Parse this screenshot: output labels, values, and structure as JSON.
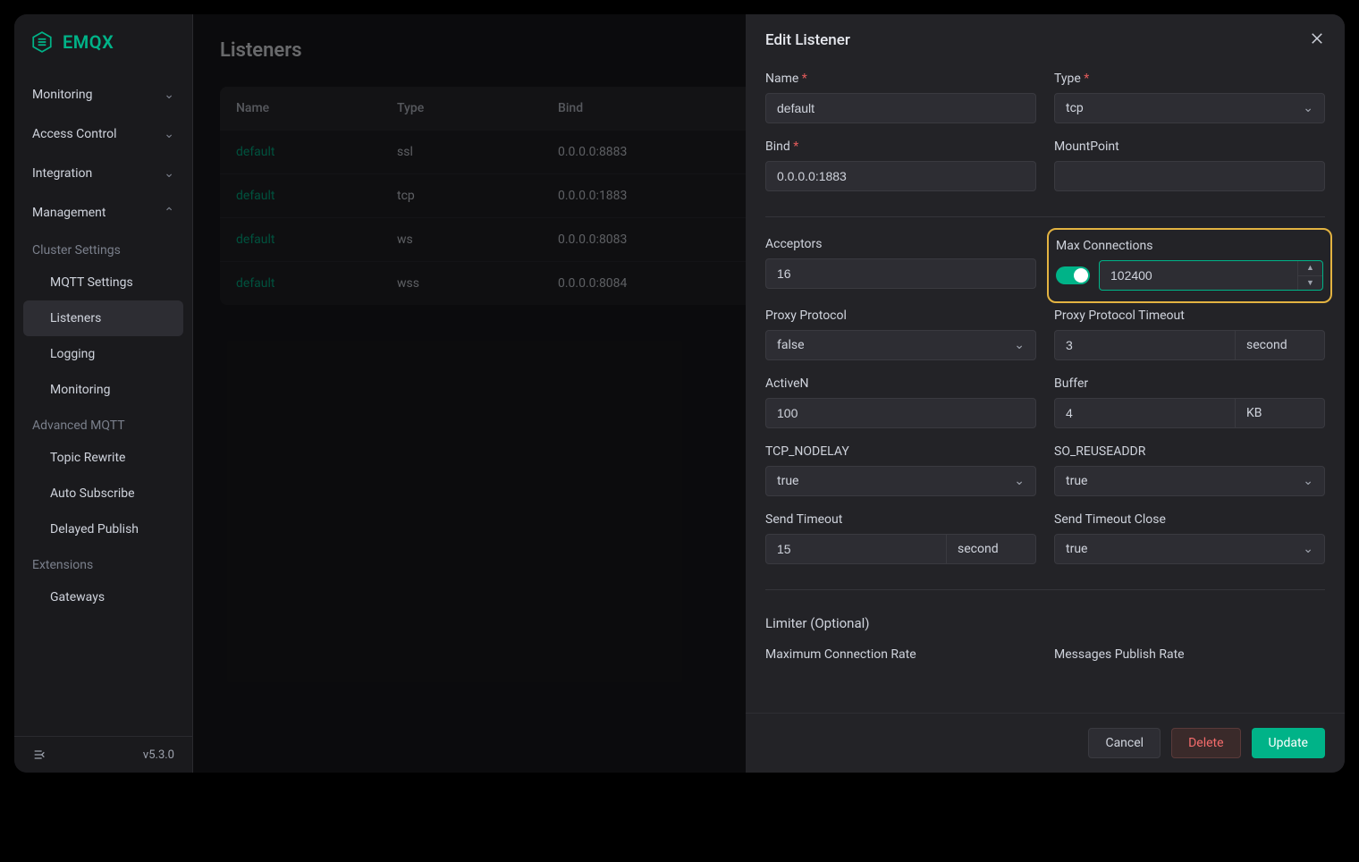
{
  "brand": "EMQX",
  "version": "v5.3.0",
  "sidebar": {
    "monitoring": "Monitoring",
    "access_control": "Access Control",
    "integration": "Integration",
    "management": "Management",
    "cluster_settings": "Cluster Settings",
    "mqtt_settings": "MQTT Settings",
    "listeners": "Listeners",
    "logging": "Logging",
    "monitoring_sub": "Monitoring",
    "advanced_mqtt": "Advanced MQTT",
    "topic_rewrite": "Topic Rewrite",
    "auto_subscribe": "Auto Subscribe",
    "delayed_publish": "Delayed Publish",
    "extensions": "Extensions",
    "gateways": "Gateways"
  },
  "page": {
    "title": "Listeners"
  },
  "table": {
    "headers": {
      "name": "Name",
      "type": "Type",
      "bind": "Bind"
    },
    "rows": [
      {
        "name": "default",
        "type": "ssl",
        "bind": "0.0.0.0:8883"
      },
      {
        "name": "default",
        "type": "tcp",
        "bind": "0.0.0.0:1883"
      },
      {
        "name": "default",
        "type": "ws",
        "bind": "0.0.0.0:8083"
      },
      {
        "name": "default",
        "type": "wss",
        "bind": "0.0.0.0:8084"
      }
    ]
  },
  "drawer": {
    "title": "Edit Listener",
    "name_label": "Name",
    "name_value": "default",
    "type_label": "Type",
    "type_value": "tcp",
    "bind_label": "Bind",
    "bind_value": "0.0.0.0:1883",
    "mountpoint_label": "MountPoint",
    "mountpoint_value": "",
    "acceptors_label": "Acceptors",
    "acceptors_value": "16",
    "maxconn_label": "Max Connections",
    "maxconn_value": "102400",
    "proxy_protocol_label": "Proxy Protocol",
    "proxy_protocol_value": "false",
    "proxy_timeout_label": "Proxy Protocol Timeout",
    "proxy_timeout_value": "3",
    "proxy_timeout_unit": "second",
    "activen_label": "ActiveN",
    "activen_value": "100",
    "buffer_label": "Buffer",
    "buffer_value": "4",
    "buffer_unit": "KB",
    "tcp_nodelay_label": "TCP_NODELAY",
    "tcp_nodelay_value": "true",
    "so_reuseaddr_label": "SO_REUSEADDR",
    "so_reuseaddr_value": "true",
    "send_timeout_label": "Send Timeout",
    "send_timeout_value": "15",
    "send_timeout_unit": "second",
    "send_timeout_close_label": "Send Timeout Close",
    "send_timeout_close_value": "true",
    "limiter_title": "Limiter (Optional)",
    "max_conn_rate_label": "Maximum Connection Rate",
    "msg_publish_rate_label": "Messages Publish Rate",
    "cancel": "Cancel",
    "delete": "Delete",
    "update": "Update"
  }
}
